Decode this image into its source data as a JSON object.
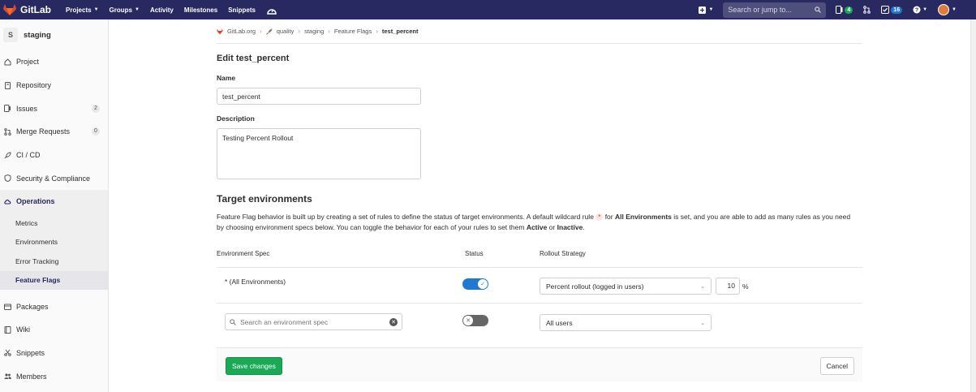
{
  "topbar": {
    "brand": "GitLab",
    "nav": [
      {
        "label": "Projects",
        "has_dropdown": true
      },
      {
        "label": "Groups",
        "has_dropdown": true
      },
      {
        "label": "Activity",
        "has_dropdown": false
      },
      {
        "label": "Milestones",
        "has_dropdown": false
      },
      {
        "label": "Snippets",
        "has_dropdown": false
      }
    ],
    "search_placeholder": "Search or jump to...",
    "issues_count": "4",
    "todos_count": "16",
    "colors": {
      "bg": "#292961",
      "green_badge": "#1aaa55",
      "blue_badge": "#1f78d1"
    }
  },
  "sidebar": {
    "project_initial": "S",
    "project_name": "staging",
    "items": [
      {
        "label": "Project",
        "icon": "home-icon"
      },
      {
        "label": "Repository",
        "icon": "book-icon"
      },
      {
        "label": "Issues",
        "icon": "issues-icon",
        "count": "2"
      },
      {
        "label": "Merge Requests",
        "icon": "merge-request-icon",
        "count": "0"
      },
      {
        "label": "CI / CD",
        "icon": "rocket-icon"
      },
      {
        "label": "Security & Compliance",
        "icon": "shield-icon"
      },
      {
        "label": "Operations",
        "icon": "cloud-gear-icon"
      }
    ],
    "operations_sub": [
      {
        "label": "Metrics"
      },
      {
        "label": "Environments"
      },
      {
        "label": "Error Tracking"
      },
      {
        "label": "Feature Flags"
      }
    ],
    "items_after": [
      {
        "label": "Packages",
        "icon": "package-icon"
      },
      {
        "label": "Wiki",
        "icon": "wiki-icon"
      },
      {
        "label": "Snippets",
        "icon": "snippet-icon"
      },
      {
        "label": "Members",
        "icon": "users-icon"
      }
    ]
  },
  "breadcrumb": [
    "GitLab.org",
    "quality",
    "staging",
    "Feature Flags",
    "test_percent"
  ],
  "form": {
    "title": "Edit test_percent",
    "name_label": "Name",
    "name_value": "test_percent",
    "description_label": "Description",
    "description_value": "Testing Percent Rollout"
  },
  "target": {
    "heading": "Target environments",
    "para_1": "Feature Flag behavior is built up by creating a set of rules to define the status of target environments. A default wildcard rule",
    "para_wild": "*",
    "para_2": "for",
    "para_bold_1": "All Environments",
    "para_3": "is set, and you are able to add as many rules as you need by choosing environment specs below. You can toggle the behavior for each of your rules to set them",
    "para_bold_2": "Active",
    "para_4": "or",
    "para_bold_3": "Inactive",
    "para_5": ".",
    "columns": [
      "Environment Spec",
      "Status",
      "Rollout Strategy"
    ],
    "row_all": {
      "spec": "* (All Environments)",
      "status_on": true,
      "strategy": "Percent rollout (logged in users)",
      "percent": "10",
      "percent_sym": "%"
    },
    "row_new": {
      "search_placeholder": "Search an environment spec",
      "status_on": false,
      "strategy": "All users"
    }
  },
  "footer": {
    "save_label": "Save changes",
    "cancel_label": "Cancel"
  }
}
